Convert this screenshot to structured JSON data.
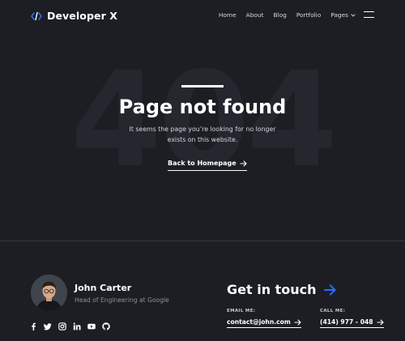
{
  "brand": {
    "name": "Developer X",
    "icon": "code-brackets-icon",
    "accent": "#2c6bff"
  },
  "nav": {
    "items": [
      {
        "label": "Home"
      },
      {
        "label": "About"
      },
      {
        "label": "Blog"
      },
      {
        "label": "Portfolio"
      },
      {
        "label": "Pages",
        "icon": "chevron-down-icon"
      }
    ],
    "menu_icon": "hamburger-icon"
  },
  "hero": {
    "background_text": "404",
    "title": "Page not found",
    "description": "It seems the page you’re looking for no longer exists on this website.",
    "cta_label": "Back to Homepage"
  },
  "footer": {
    "person": {
      "name": "John Carter",
      "role": "Head of Engineering at Google"
    },
    "socials": [
      "facebook-icon",
      "twitter-icon",
      "instagram-icon",
      "linkedin-icon",
      "youtube-icon",
      "github-icon"
    ],
    "contact_title": "Get in touch",
    "email_label": "EMAIL ME:",
    "email": "contact@john.com",
    "phone_label": "CALL ME:",
    "phone": "(414) 977 - 048"
  }
}
